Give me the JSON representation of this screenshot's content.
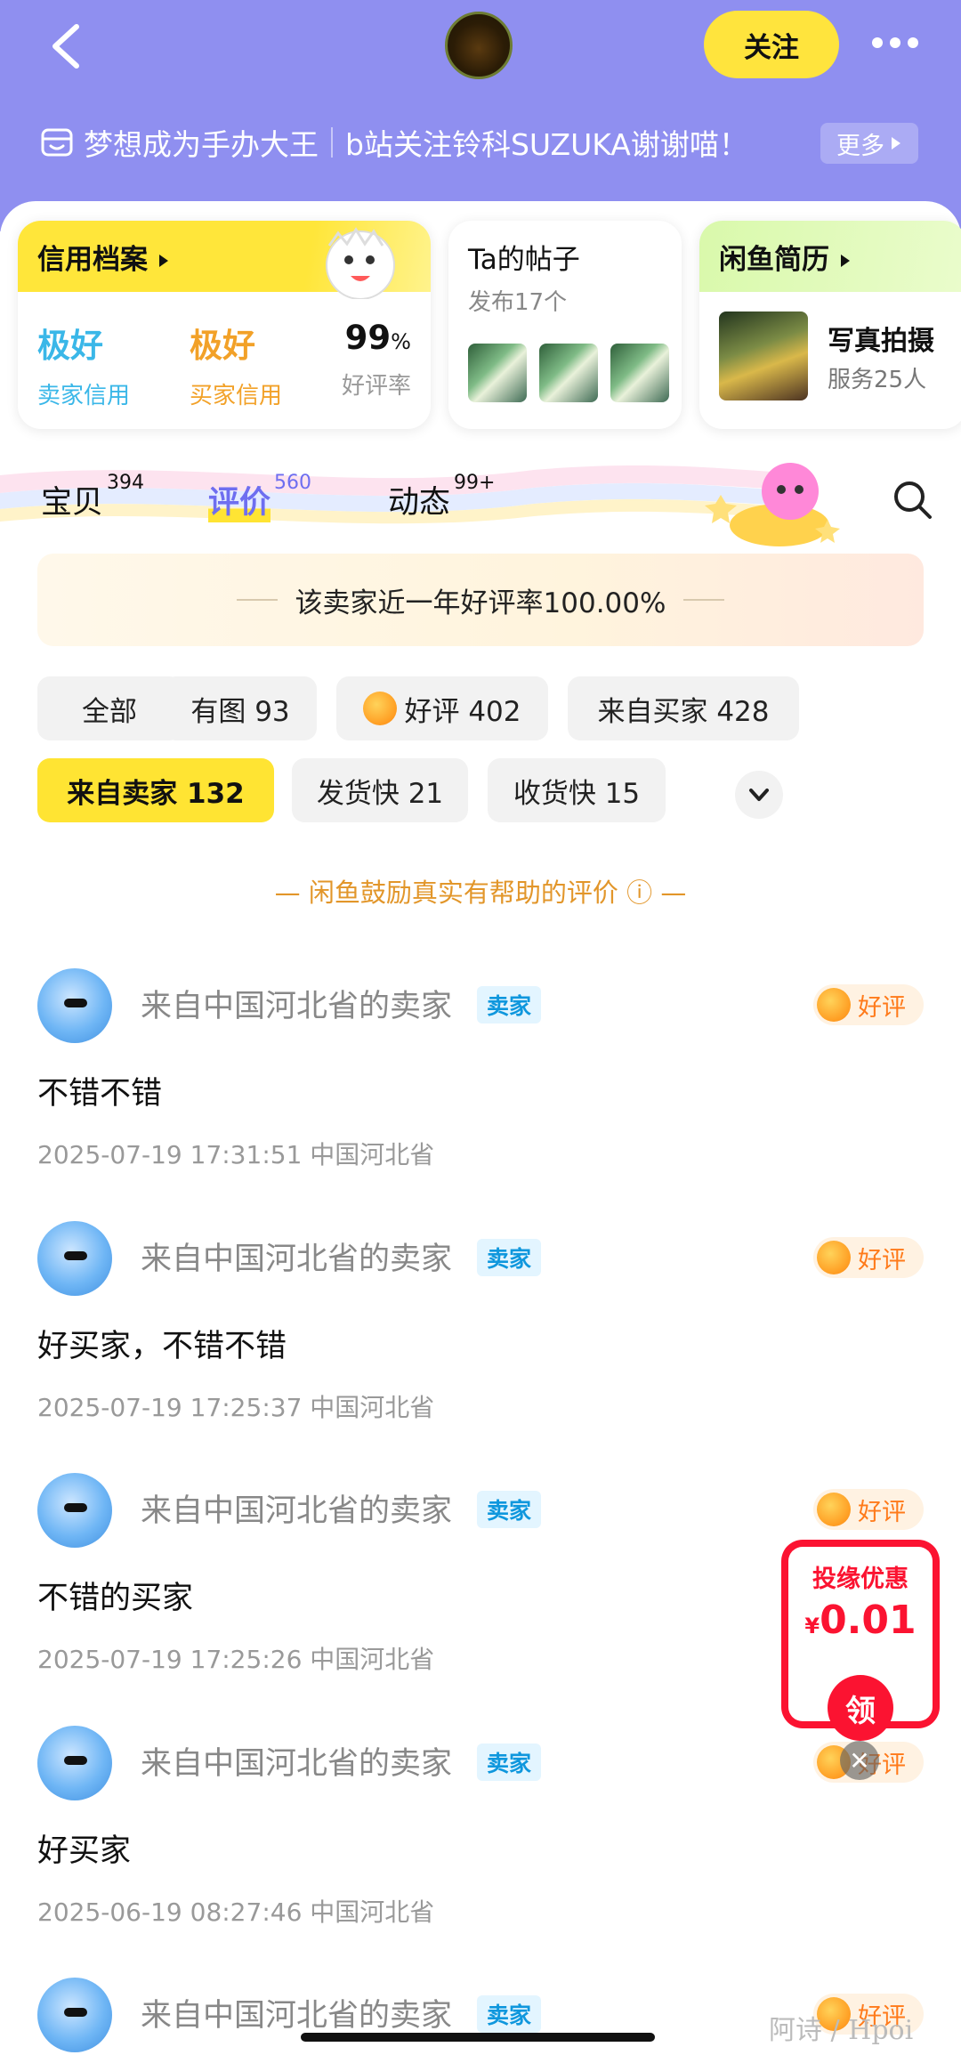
{
  "header": {
    "follow_label": "关注",
    "bio": "梦想成为手办大王",
    "bio_extra": "b站关注铃科SUZUKA谢谢喵！",
    "more_label": "更多",
    "bg_color": "#8f8ff0"
  },
  "cards": {
    "credit": {
      "title": "信用档案",
      "seller_value": "极好",
      "seller_label": "卖家信用",
      "buyer_value": "极好",
      "buyer_label": "买家信用",
      "rate_value": "99",
      "rate_unit": "%",
      "rate_label": "好评率"
    },
    "posts": {
      "title": "Ta的帖子",
      "subtitle": "发布17个"
    },
    "resume": {
      "title": "闲鱼简历",
      "service_title": "写真拍摄",
      "service_sub": "服务25人"
    }
  },
  "tabs": [
    {
      "label": "宝贝",
      "count": "394"
    },
    {
      "label": "评价",
      "count": "560"
    },
    {
      "label": "动态",
      "count": "99+"
    }
  ],
  "banner": "该卖家近一年好评率100.00%",
  "filters": [
    {
      "label": "全部"
    },
    {
      "label": "有图 93"
    },
    {
      "label": "好评 402"
    },
    {
      "label": "来自买家 428"
    },
    {
      "label": "来自卖家 132"
    },
    {
      "label": "发货快 21"
    },
    {
      "label": "收货快 15"
    }
  ],
  "tip": "— 闲鱼鼓励真实有帮助的评价 ⓘ —",
  "reviews": [
    {
      "name": "来自中国河北省的卖家",
      "tag": "卖家",
      "badge": "好评",
      "text": "不错不错",
      "meta": "2025-07-19 17:31:51  中国河北省"
    },
    {
      "name": "来自中国河北省的卖家",
      "tag": "卖家",
      "badge": "好评",
      "text": "好买家，不错不错",
      "meta": "2025-07-19 17:25:37  中国河北省"
    },
    {
      "name": "来自中国河北省的卖家",
      "tag": "卖家",
      "badge": "好评",
      "text": "不错的买家",
      "meta": "2025-07-19 17:25:26  中国河北省"
    },
    {
      "name": "来自中国河北省的卖家",
      "tag": "卖家",
      "badge": "好评",
      "text": "好买家",
      "meta": "2025-06-19 08:27:46  中国河北省"
    },
    {
      "name": "来自中国河北省的卖家",
      "tag": "卖家",
      "badge": "好评",
      "text": "",
      "meta": ""
    }
  ],
  "coupon": {
    "title": "投缘优惠",
    "currency": "¥",
    "price": "0.01",
    "button": "领"
  },
  "watermark": "阿诗 / Hpoi"
}
